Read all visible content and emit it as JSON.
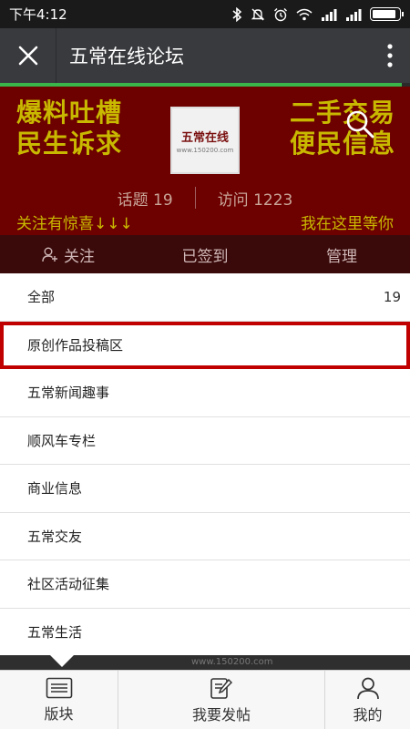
{
  "status": {
    "time": "下午4:12",
    "battery_level": 0.95
  },
  "titlebar": {
    "title": "五常在线论坛"
  },
  "page_load_progress": 0.98,
  "banner": {
    "slogan_left": [
      "爆料吐槽",
      "民生诉求"
    ],
    "slogan_right": [
      "二手交易",
      "便民信息"
    ],
    "logo_text": "五常在线",
    "logo_url": "www.150200.com",
    "stats": {
      "topics": "话题 19",
      "visits": "访问 1223"
    },
    "teaser_left": "关注有惊喜↓↓↓",
    "teaser_right": "我在这里等你"
  },
  "actions": {
    "follow": "关注",
    "signed": "已签到",
    "manage": "管理"
  },
  "categories": [
    {
      "label": "全部",
      "count": "19"
    },
    {
      "label": "原创作品投稿区",
      "count": ""
    },
    {
      "label": "五常新闻趣事",
      "count": ""
    },
    {
      "label": "顺风车专栏",
      "count": ""
    },
    {
      "label": "商业信息",
      "count": ""
    },
    {
      "label": "五常交友",
      "count": ""
    },
    {
      "label": "社区活动征集",
      "count": ""
    },
    {
      "label": "五常生活",
      "count": ""
    }
  ],
  "selected_category_index": 1,
  "under_watermark": "www.150200.com",
  "tabs": {
    "sections": "版块",
    "post": "我要发帖",
    "mine": "我的"
  },
  "colors": {
    "banner": "#6d0100",
    "slogan": "#c9b800",
    "selection": "#c00000",
    "progress": "#3ab54a"
  }
}
